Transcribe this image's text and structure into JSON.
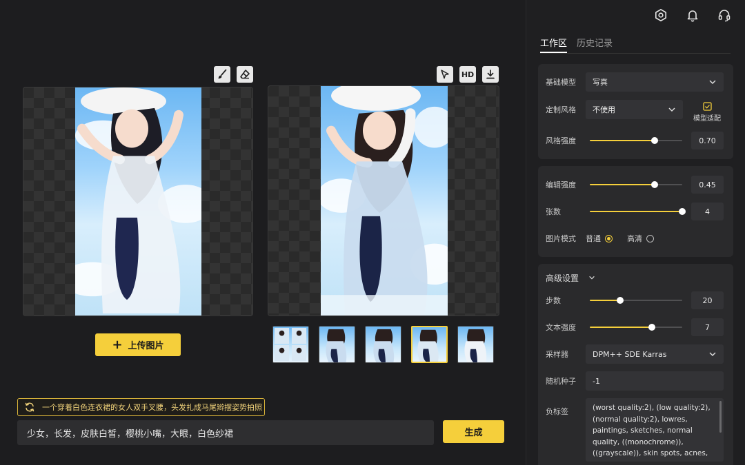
{
  "toolbar_left": {
    "brush_icon": "brush-icon",
    "eraser_icon": "eraser-icon"
  },
  "toolbar_right": {
    "select_icon": "pointer-select-icon",
    "hd_label": "HD",
    "download_icon": "download-icon"
  },
  "upload_button_label": "上传图片",
  "thumbnails": [
    {
      "selected": false
    },
    {
      "selected": false
    },
    {
      "selected": false
    },
    {
      "selected": true
    },
    {
      "selected": false
    }
  ],
  "hint": {
    "text": "一个穿着白色连衣裙的女人双手叉腰，头发扎成马尾辫摆姿势拍照"
  },
  "prompt": {
    "value": "少女，长发，皮肤白皙，樱桃小嘴，大眼，白色纱裙"
  },
  "generate_button_label": "生成",
  "header_icons": [
    "settings-icon",
    "bell-icon",
    "headset-icon"
  ],
  "tabs": [
    {
      "label": "工作区",
      "active": true
    },
    {
      "label": "历史记录",
      "active": false
    }
  ],
  "section1": {
    "base_model": {
      "label": "基础模型",
      "value": "写真"
    },
    "custom_style": {
      "label": "定制风格",
      "value": "不使用"
    },
    "model_adapt": {
      "label": "模型适配",
      "checked": true
    },
    "style_strength": {
      "label": "风格强度",
      "value": "0.70",
      "fraction": 0.7
    }
  },
  "section2": {
    "edit_strength": {
      "label": "编辑强度",
      "value": "0.45",
      "fraction": 0.7
    },
    "count": {
      "label": "张数",
      "value": "4",
      "fraction": 1.0
    },
    "image_mode": {
      "label": "图片模式",
      "options": [
        "普通",
        "高清"
      ],
      "selected": "普通"
    }
  },
  "section3": {
    "title": "高级设置",
    "steps": {
      "label": "步数",
      "value": "20",
      "fraction": 0.33
    },
    "text_strength": {
      "label": "文本强度",
      "value": "7",
      "fraction": 0.67
    },
    "sampler": {
      "label": "采样器",
      "value": "DPM++ SDE Karras"
    },
    "seed": {
      "label": "随机种子",
      "value": "-1"
    },
    "negative": {
      "label": "负标签",
      "value": "(worst quality:2), (low quality:2), (normal quality:2), lowres, paintings, sketches, normal quality, ((monochrome)), ((grayscale)), skin spots, acnes, skin blemishes, age"
    }
  },
  "colors": {
    "accent": "#f5cf3b",
    "background": "#1d1d1f",
    "panel": "#2a2a2c"
  }
}
